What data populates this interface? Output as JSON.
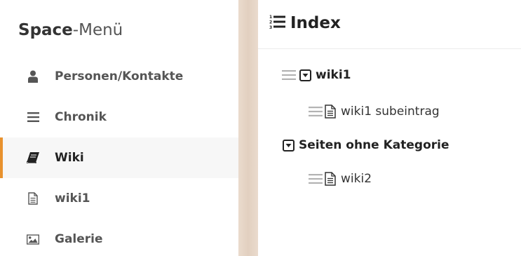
{
  "sidebar": {
    "title_bold": "Space",
    "title_light": "-Menü",
    "items": [
      {
        "label": "Personen/Kontakte",
        "icon": "person-icon"
      },
      {
        "label": "Chronik",
        "icon": "list-icon"
      },
      {
        "label": "Wiki",
        "icon": "book-icon",
        "active": true
      },
      {
        "label": "wiki1",
        "icon": "document-icon"
      },
      {
        "label": "Galerie",
        "icon": "image-icon"
      }
    ]
  },
  "main": {
    "title": "Index",
    "title_icon": "numbered-list-icon",
    "tree": [
      {
        "label": "wiki1",
        "level": 0,
        "draggable": true,
        "collapsible": true
      },
      {
        "label": "wiki1 subeintrag",
        "level": 1,
        "draggable": true,
        "doc": true
      },
      {
        "label": "Seiten ohne Kategorie",
        "level": 0,
        "draggable": false,
        "collapsible": true
      },
      {
        "label": "wiki2",
        "level": 1,
        "draggable": true,
        "doc": true
      }
    ]
  },
  "colors": {
    "accent": "#e8922e",
    "active_bg": "#f7f7f7",
    "divider": "#e2d0c0",
    "handle": "#b3b3b3"
  }
}
